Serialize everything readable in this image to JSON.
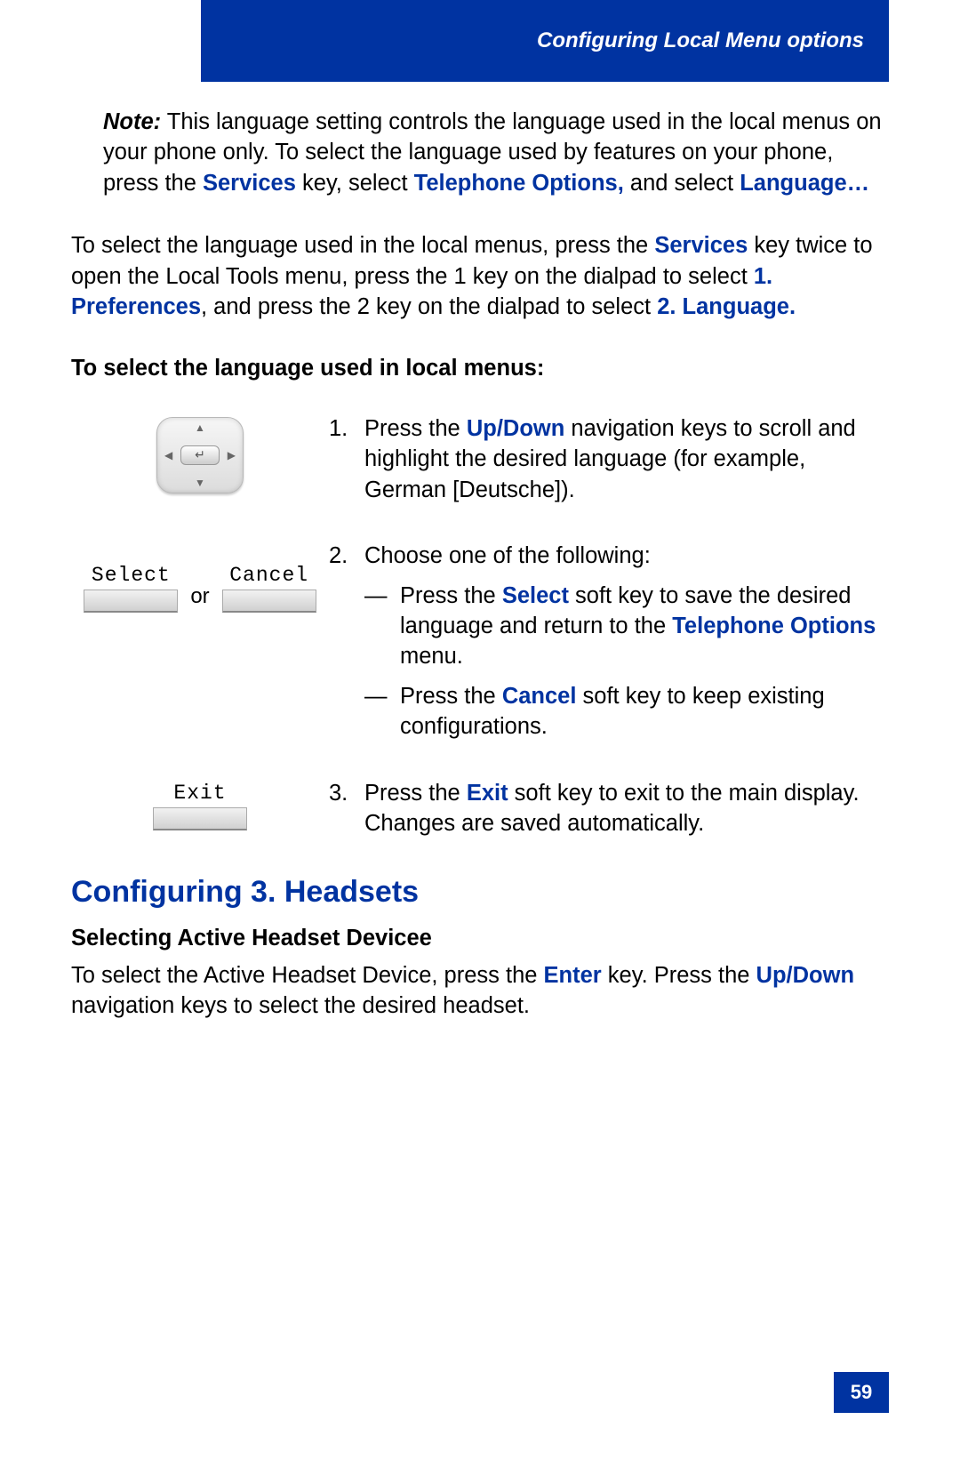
{
  "header": {
    "title": "Configuring Local Menu options"
  },
  "note": {
    "label": "Note:",
    "text_before": " This language setting controls the language used in the local menus on your phone only. To select the language used by features on your phone, press the ",
    "link1": "Services",
    "text_mid1": " key, select ",
    "link2": "Telephone Options,",
    "text_mid2": " and select ",
    "link3": "Language…"
  },
  "intro": {
    "t1": "To select the language used in the local menus, press the ",
    "l1": "Services",
    "t2": " key twice to open the Local Tools menu, press the 1 key on the dialpad to select ",
    "l2": "1. Preferences",
    "t3": ", and press the 2 key on the dialpad to select ",
    "l3": "2. Language."
  },
  "proc_heading": "To select the language used in local menus:",
  "steps": {
    "s1": {
      "num": "1.",
      "t1": "Press the ",
      "l1": "Up",
      "slash": "/",
      "l2": "Down",
      "t2": " navigation keys to scroll and highlight the desired language (for example, German [Deutsche])."
    },
    "s2": {
      "num": "2.",
      "intro": "Choose one of the following:",
      "a_t1": "Press the ",
      "a_l1": "Select",
      "a_t2": " soft key to save the desired language and return to the ",
      "a_l2": "Telephone Options",
      "a_t3": " menu.",
      "b_t1": "Press the ",
      "b_l1": "Cancel",
      "b_t2": " soft key to keep existing configurations."
    },
    "s3": {
      "num": "3.",
      "t1": "Press the ",
      "l1": "Exit",
      "t2": " soft key to exit to the main display. Changes are saved automatically."
    }
  },
  "softkeys": {
    "select": "Select",
    "cancel": "Cancel",
    "or": "or",
    "exit": "Exit"
  },
  "section2": {
    "heading": "Configuring 3. Headsets",
    "subheading": "Selecting Active Headset Devicee",
    "p_t1": "To select the Active Headset Device, press the ",
    "p_l1": "Enter",
    "p_t2": " key. Press the ",
    "p_l2": "Up",
    "p_slash": "/",
    "p_l3": "Down",
    "p_t3": " navigation keys to select the desired headset."
  },
  "page_number": "59"
}
